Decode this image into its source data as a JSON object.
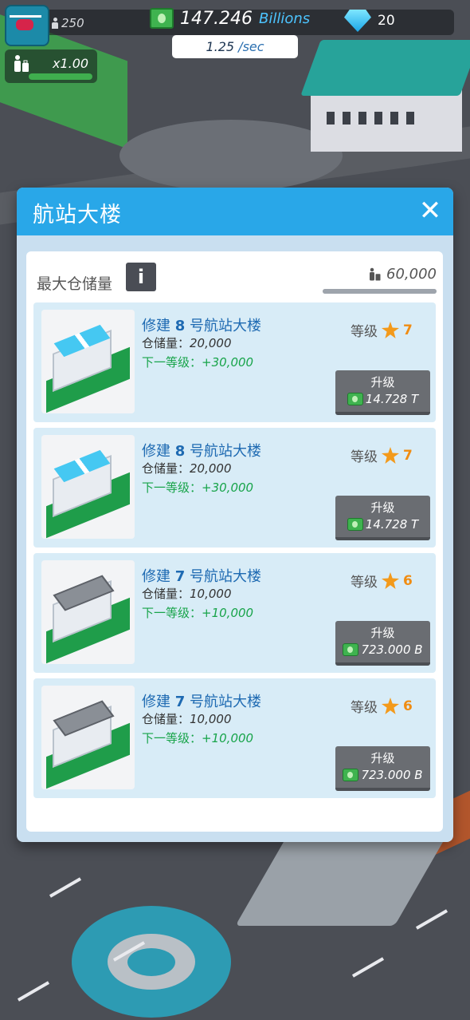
{
  "hud": {
    "passengers": "250",
    "money": "147.246",
    "money_unit": "Billions",
    "rate_value": "1.25",
    "rate_suffix": "/sec",
    "gems": "20",
    "speed": "x1.00",
    "speed_fill": 1.0
  },
  "dialog": {
    "title": "航站大楼",
    "close_icon": "close-icon",
    "capacity_label": "最大仓储量",
    "info_label": "i",
    "capacity_value": "60,000",
    "capacity_fill": 1.0
  },
  "cards": [
    {
      "title_prefix": "修建 ",
      "title_num": "8",
      "title_suffix": " 号航站大楼",
      "cap_label": "仓储量：",
      "cap_value": "20,000",
      "next_label": "下一等级：",
      "next_value": "+30,000",
      "level_label": "等级",
      "level": "7",
      "upgrade_label": "升级",
      "price": "14.728 T",
      "roof": "solar"
    },
    {
      "title_prefix": "修建 ",
      "title_num": "8",
      "title_suffix": " 号航站大楼",
      "cap_label": "仓储量：",
      "cap_value": "20,000",
      "next_label": "下一等级：",
      "next_value": "+30,000",
      "level_label": "等级",
      "level": "7",
      "upgrade_label": "升级",
      "price": "14.728 T",
      "roof": "solar"
    },
    {
      "title_prefix": "修建 ",
      "title_num": "7",
      "title_suffix": " 号航站大楼",
      "cap_label": "仓储量：",
      "cap_value": "10,000",
      "next_label": "下一等级：",
      "next_value": "+10,000",
      "level_label": "等级",
      "level": "6",
      "upgrade_label": "升级",
      "price": "723.000 B",
      "roof": "vents"
    },
    {
      "title_prefix": "修建 ",
      "title_num": "7",
      "title_suffix": " 号航站大楼",
      "cap_label": "仓储量：",
      "cap_value": "10,000",
      "next_label": "下一等级：",
      "next_value": "+10,000",
      "level_label": "等级",
      "level": "6",
      "upgrade_label": "升级",
      "price": "723.000 B",
      "roof": "vents"
    }
  ],
  "colors": {
    "header": "#29a7e8",
    "card_bg": "#d8ecf7",
    "title_blue": "#1e6ab2",
    "next_green": "#18a44a",
    "star_orange": "#f39a1b",
    "button_gray": "#6a6d72"
  }
}
